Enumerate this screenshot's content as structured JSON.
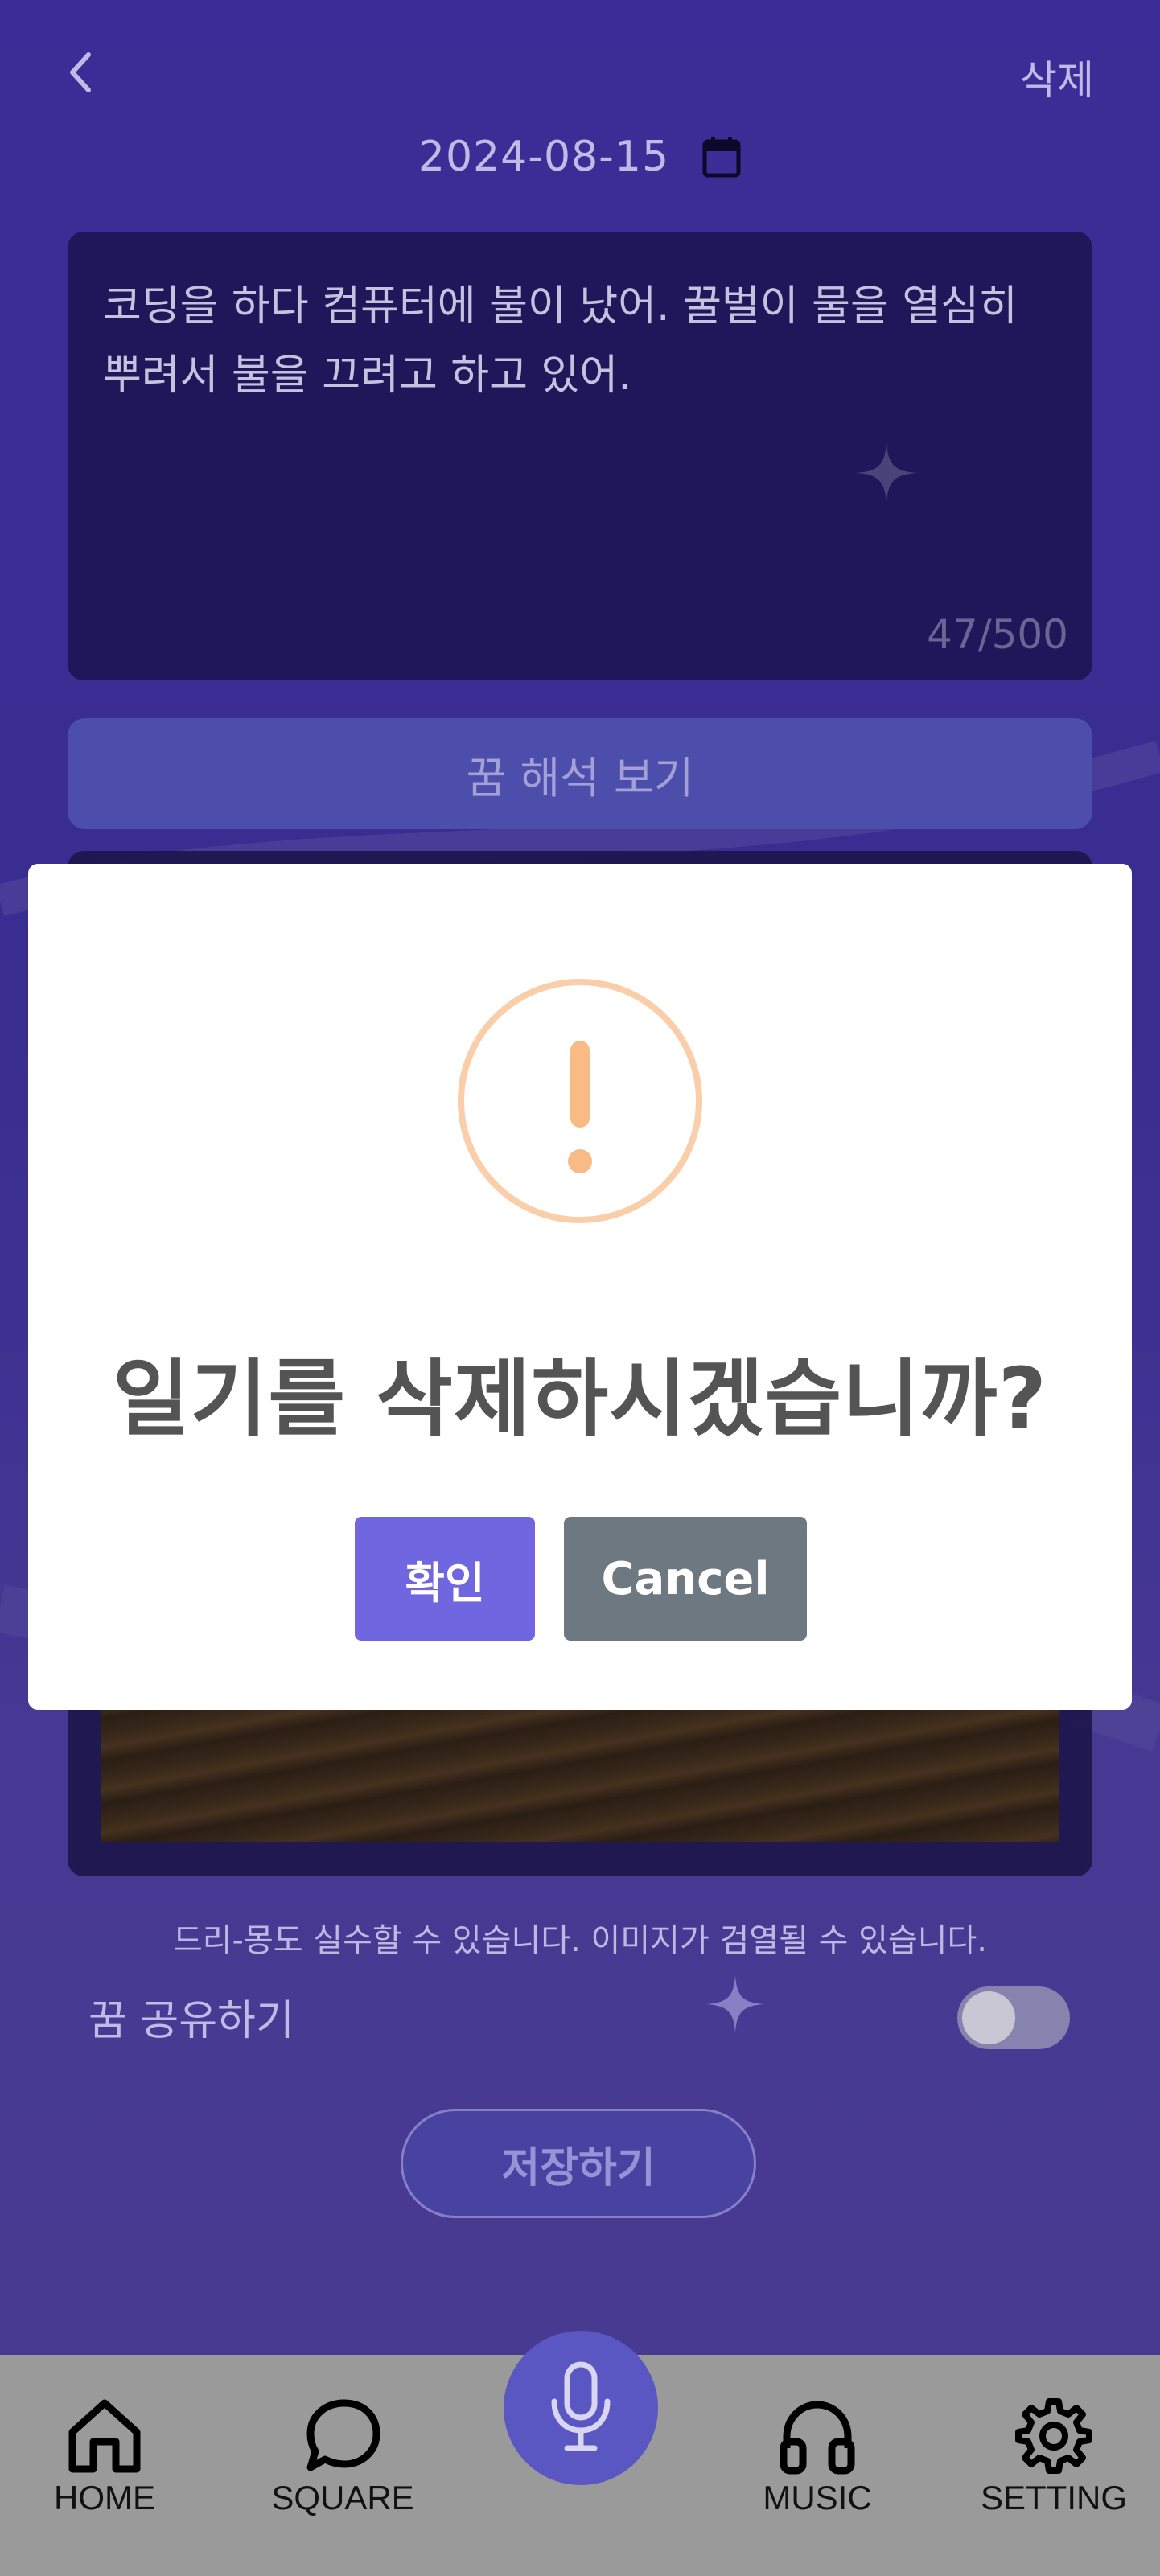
{
  "header": {
    "back_icon": "chevron-left-icon",
    "delete_label": "삭제",
    "date": "2024-08-15",
    "calendar_icon": "calendar-icon"
  },
  "diary": {
    "text": "코딩을 하다 컴퓨터에 불이 났어. 꿀벌이 물을 열심히 뿌려서 불을 끄려고 하고 있어.",
    "char_count": "47/500"
  },
  "interpret_button": "꿈 해석 보기",
  "disclaimer": "드리-몽도 실수할 수 있습니다. 이미지가 검열될 수 있습니다.",
  "share": {
    "label": "꿈 공유하기",
    "enabled": false
  },
  "save_button": "저장하기",
  "modal": {
    "icon": "warning-icon",
    "icon_color": "#f8bb86",
    "title": "일기를 삭제하시겠습니까?",
    "confirm_label": "확인",
    "cancel_label": "Cancel"
  },
  "nav": {
    "items": [
      {
        "label": "HOME",
        "icon": "home-icon"
      },
      {
        "label": "SQUARE",
        "icon": "chat-bubble-icon"
      },
      {
        "label": "MUSIC",
        "icon": "headphones-icon"
      },
      {
        "label": "SETTING",
        "icon": "gear-icon"
      }
    ],
    "center_icon": "microphone-icon"
  },
  "colors": {
    "background": "#3f2e9e",
    "primary": "#7066e0",
    "cancel": "#6e7881",
    "nav_background": "#9a9a9a"
  }
}
